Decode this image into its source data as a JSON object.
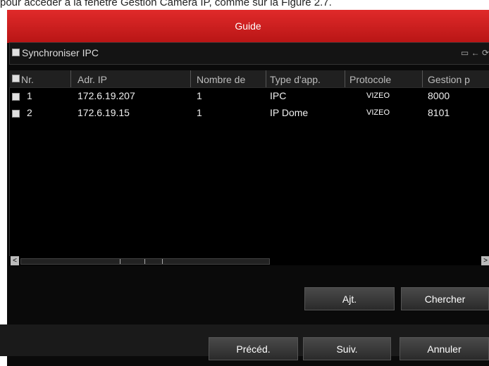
{
  "doc_caption": "pour accéder à la fenêtre Gestion Caméra IP, comme sur la Figure 2.7.",
  "window": {
    "title": "Guide"
  },
  "sync": {
    "label": "Synchroniser IPC"
  },
  "table": {
    "headers": [
      "Nr.",
      "Adr. IP",
      "Nombre de",
      "Type d'app.",
      "Protocole",
      "Gestion p"
    ],
    "rows": [
      {
        "nr": "1",
        "ip": "172.6.19.207",
        "count": "1",
        "type": "IPC",
        "protocol": "VIZEO",
        "port": "8000"
      },
      {
        "nr": "2",
        "ip": "172.6.19.15",
        "count": "1",
        "type": "IP Dome",
        "protocol": "VIZEO",
        "port": "8101"
      }
    ]
  },
  "buttons": {
    "add": "Ajt.",
    "search": "Chercher",
    "previous": "Précéd.",
    "next": "Suiv.",
    "cancel": "Annuler"
  },
  "icons": [
    "import-icon",
    "arrow-left-icon",
    "refresh-icon"
  ]
}
